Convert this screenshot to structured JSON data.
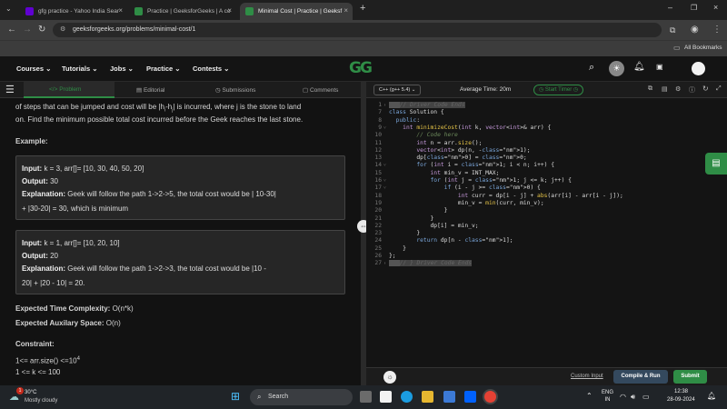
{
  "browser": {
    "tabs": [
      {
        "title": "gfg practice - Yahoo India Sear",
        "favicon_color": "#6001d2"
      },
      {
        "title": "Practice | GeeksforGeeks | A co",
        "favicon_color": "#2f8d46"
      },
      {
        "title": "Minimal Cost | Practice | Geeksf",
        "favicon_color": "#2f8d46"
      }
    ],
    "url": "geeksforgeeks.org/problems/minimal-cost/1",
    "all_bookmarks": "All Bookmarks"
  },
  "site": {
    "nav": [
      "Courses",
      "Tutorials",
      "Jobs",
      "Practice",
      "Contests"
    ],
    "logo": "GG"
  },
  "left_tabs": [
    "Problem",
    "Editorial",
    "Submissions",
    "Comments"
  ],
  "problem": {
    "intro_line1": "of steps that can be jumped and cost will be |h",
    "intro_line1_sub_i": "i",
    "intro_line1_mid": "-h",
    "intro_line1_sub_j": "j",
    "intro_line1_end": "| is incurred, where j is the stone to land",
    "intro_line2": "on. Find the minimum possible total cost incurred before the Geek reaches the last stone.",
    "example_heading": "Example:",
    "examples": [
      {
        "input_label": "Input:",
        "input": "k = 3, arr[]= [10, 30, 40, 50, 20]",
        "output_label": "Output:",
        "output": "30",
        "expl_label": "Explanation:",
        "expl1": "Geek will follow the path 1->2->5, the total cost would be | 10-30|",
        "expl2": "+ |30-20| = 30, which is minimum"
      },
      {
        "input_label": "Input:",
        "input": "k = 1, arr[]= [10, 20, 10]",
        "output_label": "Output:",
        "output": "20",
        "expl_label": "Explanation:",
        "expl1": "Geek will follow the path 1->2->3, the total cost would be |10 -",
        "expl2": "20| + |20 - 10| = 20."
      }
    ],
    "time_label": "Expected Time Complexity:",
    "time_value": "O(n*k)",
    "space_label": "Expected Auxilary Space:",
    "space_value": "O(n)",
    "constraint_heading": "Constraint:",
    "constraint1": "1<= arr.size() <=10",
    "constraint1_sup": "4",
    "constraint2": "1 <= k <= 100"
  },
  "editor": {
    "language": "C++ (g++ 5.4)",
    "average_time": "Average Time: 20m",
    "start_timer": "Start Timer",
    "lines": [
      {
        "n": "1",
        "fold": "›",
        "code": "",
        "hl": "// Driver Code Ends"
      },
      {
        "n": "7",
        "fold": "",
        "code": "class Solution {"
      },
      {
        "n": "8",
        "fold": "",
        "code": "  public:"
      },
      {
        "n": "9",
        "fold": "˅",
        "code": "    int minimizeCost(int k, vector<int>& arr) {"
      },
      {
        "n": "10",
        "fold": "",
        "code": "        // Code here"
      },
      {
        "n": "11",
        "fold": "",
        "code": "        int n = arr.size();"
      },
      {
        "n": "12",
        "fold": "",
        "code": "        vector<int> dp(n, -1);"
      },
      {
        "n": "13",
        "fold": "",
        "code": "        dp[0] = 0;"
      },
      {
        "n": "14",
        "fold": "˅",
        "code": "        for (int i = 1; i < n; i++) {"
      },
      {
        "n": "15",
        "fold": "",
        "code": "            int min_v = INT_MAX;"
      },
      {
        "n": "16",
        "fold": "˅",
        "code": "            for (int j = 1; j <= k; j++) {"
      },
      {
        "n": "17",
        "fold": "˅",
        "code": "                if (i - j >= 0) {"
      },
      {
        "n": "18",
        "fold": "",
        "code": "                    int curr = dp[i - j] + abs(arr[i] - arr[i - j]);"
      },
      {
        "n": "19",
        "fold": "",
        "code": "                    min_v = min(curr, min_v);"
      },
      {
        "n": "20",
        "fold": "",
        "code": "                }"
      },
      {
        "n": "21",
        "fold": "",
        "code": "            }"
      },
      {
        "n": "22",
        "fold": "",
        "code": "            dp[i] = min_v;"
      },
      {
        "n": "23",
        "fold": "",
        "code": "        }"
      },
      {
        "n": "24",
        "fold": "",
        "code": "        return dp[n - 1];"
      },
      {
        "n": "25",
        "fold": "",
        "code": "    }"
      },
      {
        "n": "26",
        "fold": "",
        "code": "};"
      },
      {
        "n": "27",
        "fold": "›",
        "code": "",
        "hl": "// } Driver Code Ends"
      }
    ],
    "custom_input": "Custom Input",
    "compile_run": "Compile & Run",
    "submit": "Submit"
  },
  "taskbar": {
    "weather_temp": "30°C",
    "weather_desc": "Mostly cloudy",
    "search": "Search",
    "lang1": "ENG",
    "lang2": "IN",
    "time": "12:38",
    "date": "28-09-2024",
    "notification_count": "1"
  },
  "colors": {
    "accent": "#2f8d46",
    "submit": "#2f8d46",
    "compile": "#2c3e50"
  }
}
